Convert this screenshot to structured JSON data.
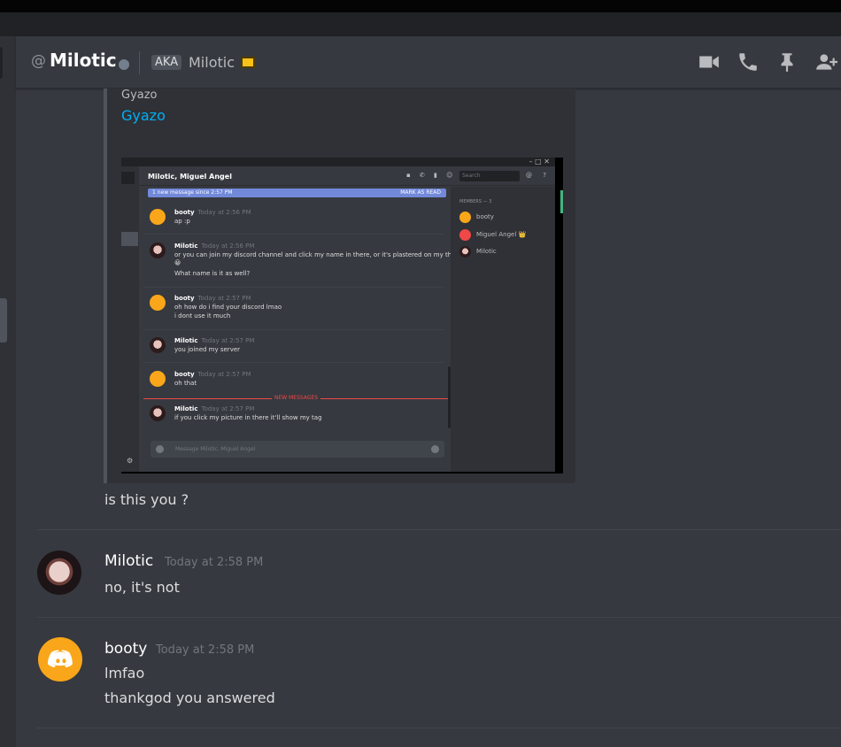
{
  "header": {
    "at_symbol": "@",
    "username": "Milotic",
    "aka_badge": "AKA",
    "aka_name": "Milotic",
    "icons": [
      "video-call-icon",
      "voice-call-icon",
      "pin-icon",
      "add-friend-icon"
    ]
  },
  "embed": {
    "provider": "Gyazo",
    "title": "Gyazo",
    "screenshot": {
      "window_controls": "–  □  ✕",
      "dm_title": "Milotic, Miguel  Angel",
      "search_placeholder": "Search",
      "header_icons": "▪ ✆ ▮ ☺ ☻",
      "header_icons_right": "@ ?",
      "new_message_banner": "1 new message since 2:57 PM",
      "mark_as_read": "MARK AS READ",
      "new_messages_divider": "NEW MESSAGES",
      "messages": [
        {
          "author": "booty",
          "time": "Today at 2:56 PM",
          "lines": [
            "ap :p"
          ]
        },
        {
          "author": "Milotic",
          "time": "Today at 2:56 PM",
          "lines": [
            "or you can join my discord channel and click my name in there, or it's plastered on my thread",
            "😀",
            "What name is it as well?"
          ]
        },
        {
          "author": "booty",
          "time": "Today at 2:57 PM",
          "lines": [
            "oh how do i find your discord lmao",
            "i dont use it much"
          ]
        },
        {
          "author": "Milotic",
          "time": "Today at 2:57 PM",
          "lines": [
            "you joined my server"
          ]
        },
        {
          "author": "booty",
          "time": "Today at 2:57 PM",
          "lines": [
            "oh that"
          ]
        },
        {
          "author": "Milotic",
          "time": "Today at 2:57 PM",
          "lines": [
            "if you click my picture in there it'll show my tag"
          ]
        }
      ],
      "members_header": "MEMBERS — 3",
      "members": [
        "booty",
        "Miguel Angel 👑",
        "Milotic"
      ],
      "composer_placeholder": "Message Milotic, Miguel Angel",
      "settings_glyph": "⚙"
    }
  },
  "messages": [
    {
      "text": "is this you ?"
    },
    {
      "author": "Milotic",
      "time": "Today at 2:58 PM",
      "lines": [
        "no, it's not"
      ]
    },
    {
      "author": "booty",
      "time": "Today at 2:58 PM",
      "lines": [
        "lmfao",
        "thankgod you answered"
      ]
    }
  ],
  "colors": {
    "background": "#36393f",
    "link": "#00b0f4",
    "default_avatar": "#faa61a",
    "status_offline": "#747f8d"
  }
}
